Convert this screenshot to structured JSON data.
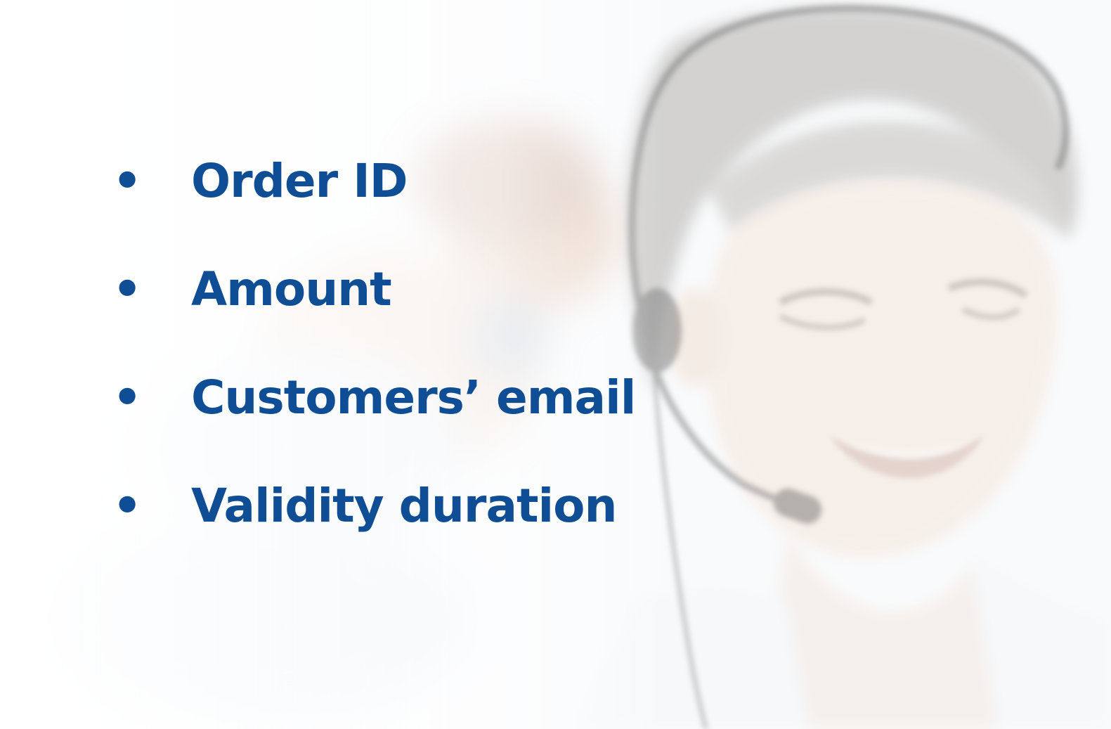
{
  "slide": {
    "bullets": [
      {
        "marker": "•",
        "text": "Order ID"
      },
      {
        "marker": "•",
        "text": "Amount"
      },
      {
        "marker": "•",
        "text": "Customers’ email"
      },
      {
        "marker": "•",
        "text": "Validity duration"
      }
    ],
    "text_color": "#0f4e94",
    "background_image": "faded photo of smiling call-center agent wearing a headset"
  }
}
